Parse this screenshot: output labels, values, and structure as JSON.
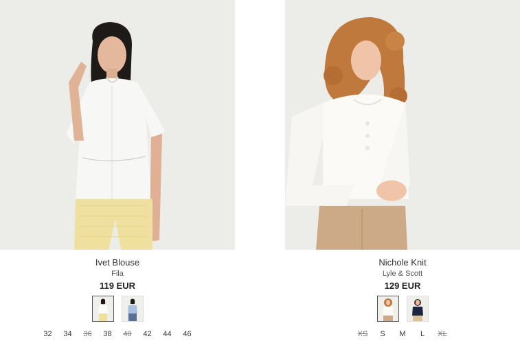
{
  "products": [
    {
      "name": "Ivet Blouse",
      "brand": "Fila",
      "price": "119 EUR",
      "swatches": [
        {
          "color": "white",
          "selected": true
        },
        {
          "color": "light-blue",
          "selected": false
        }
      ],
      "sizes": [
        {
          "label": "32",
          "available": true
        },
        {
          "label": "34",
          "available": true
        },
        {
          "label": "36",
          "available": false
        },
        {
          "label": "38",
          "available": true
        },
        {
          "label": "40",
          "available": false
        },
        {
          "label": "42",
          "available": true
        },
        {
          "label": "44",
          "available": true
        },
        {
          "label": "46",
          "available": true
        }
      ]
    },
    {
      "name": "Nichole Knit",
      "brand": "Lyle & Scott",
      "price": "129 EUR",
      "swatches": [
        {
          "color": "cream",
          "selected": true
        },
        {
          "color": "navy",
          "selected": false
        }
      ],
      "sizes": [
        {
          "label": "XS",
          "available": false
        },
        {
          "label": "S",
          "available": true
        },
        {
          "label": "M",
          "available": true
        },
        {
          "label": "L",
          "available": true
        },
        {
          "label": "XL",
          "available": false
        }
      ]
    }
  ]
}
